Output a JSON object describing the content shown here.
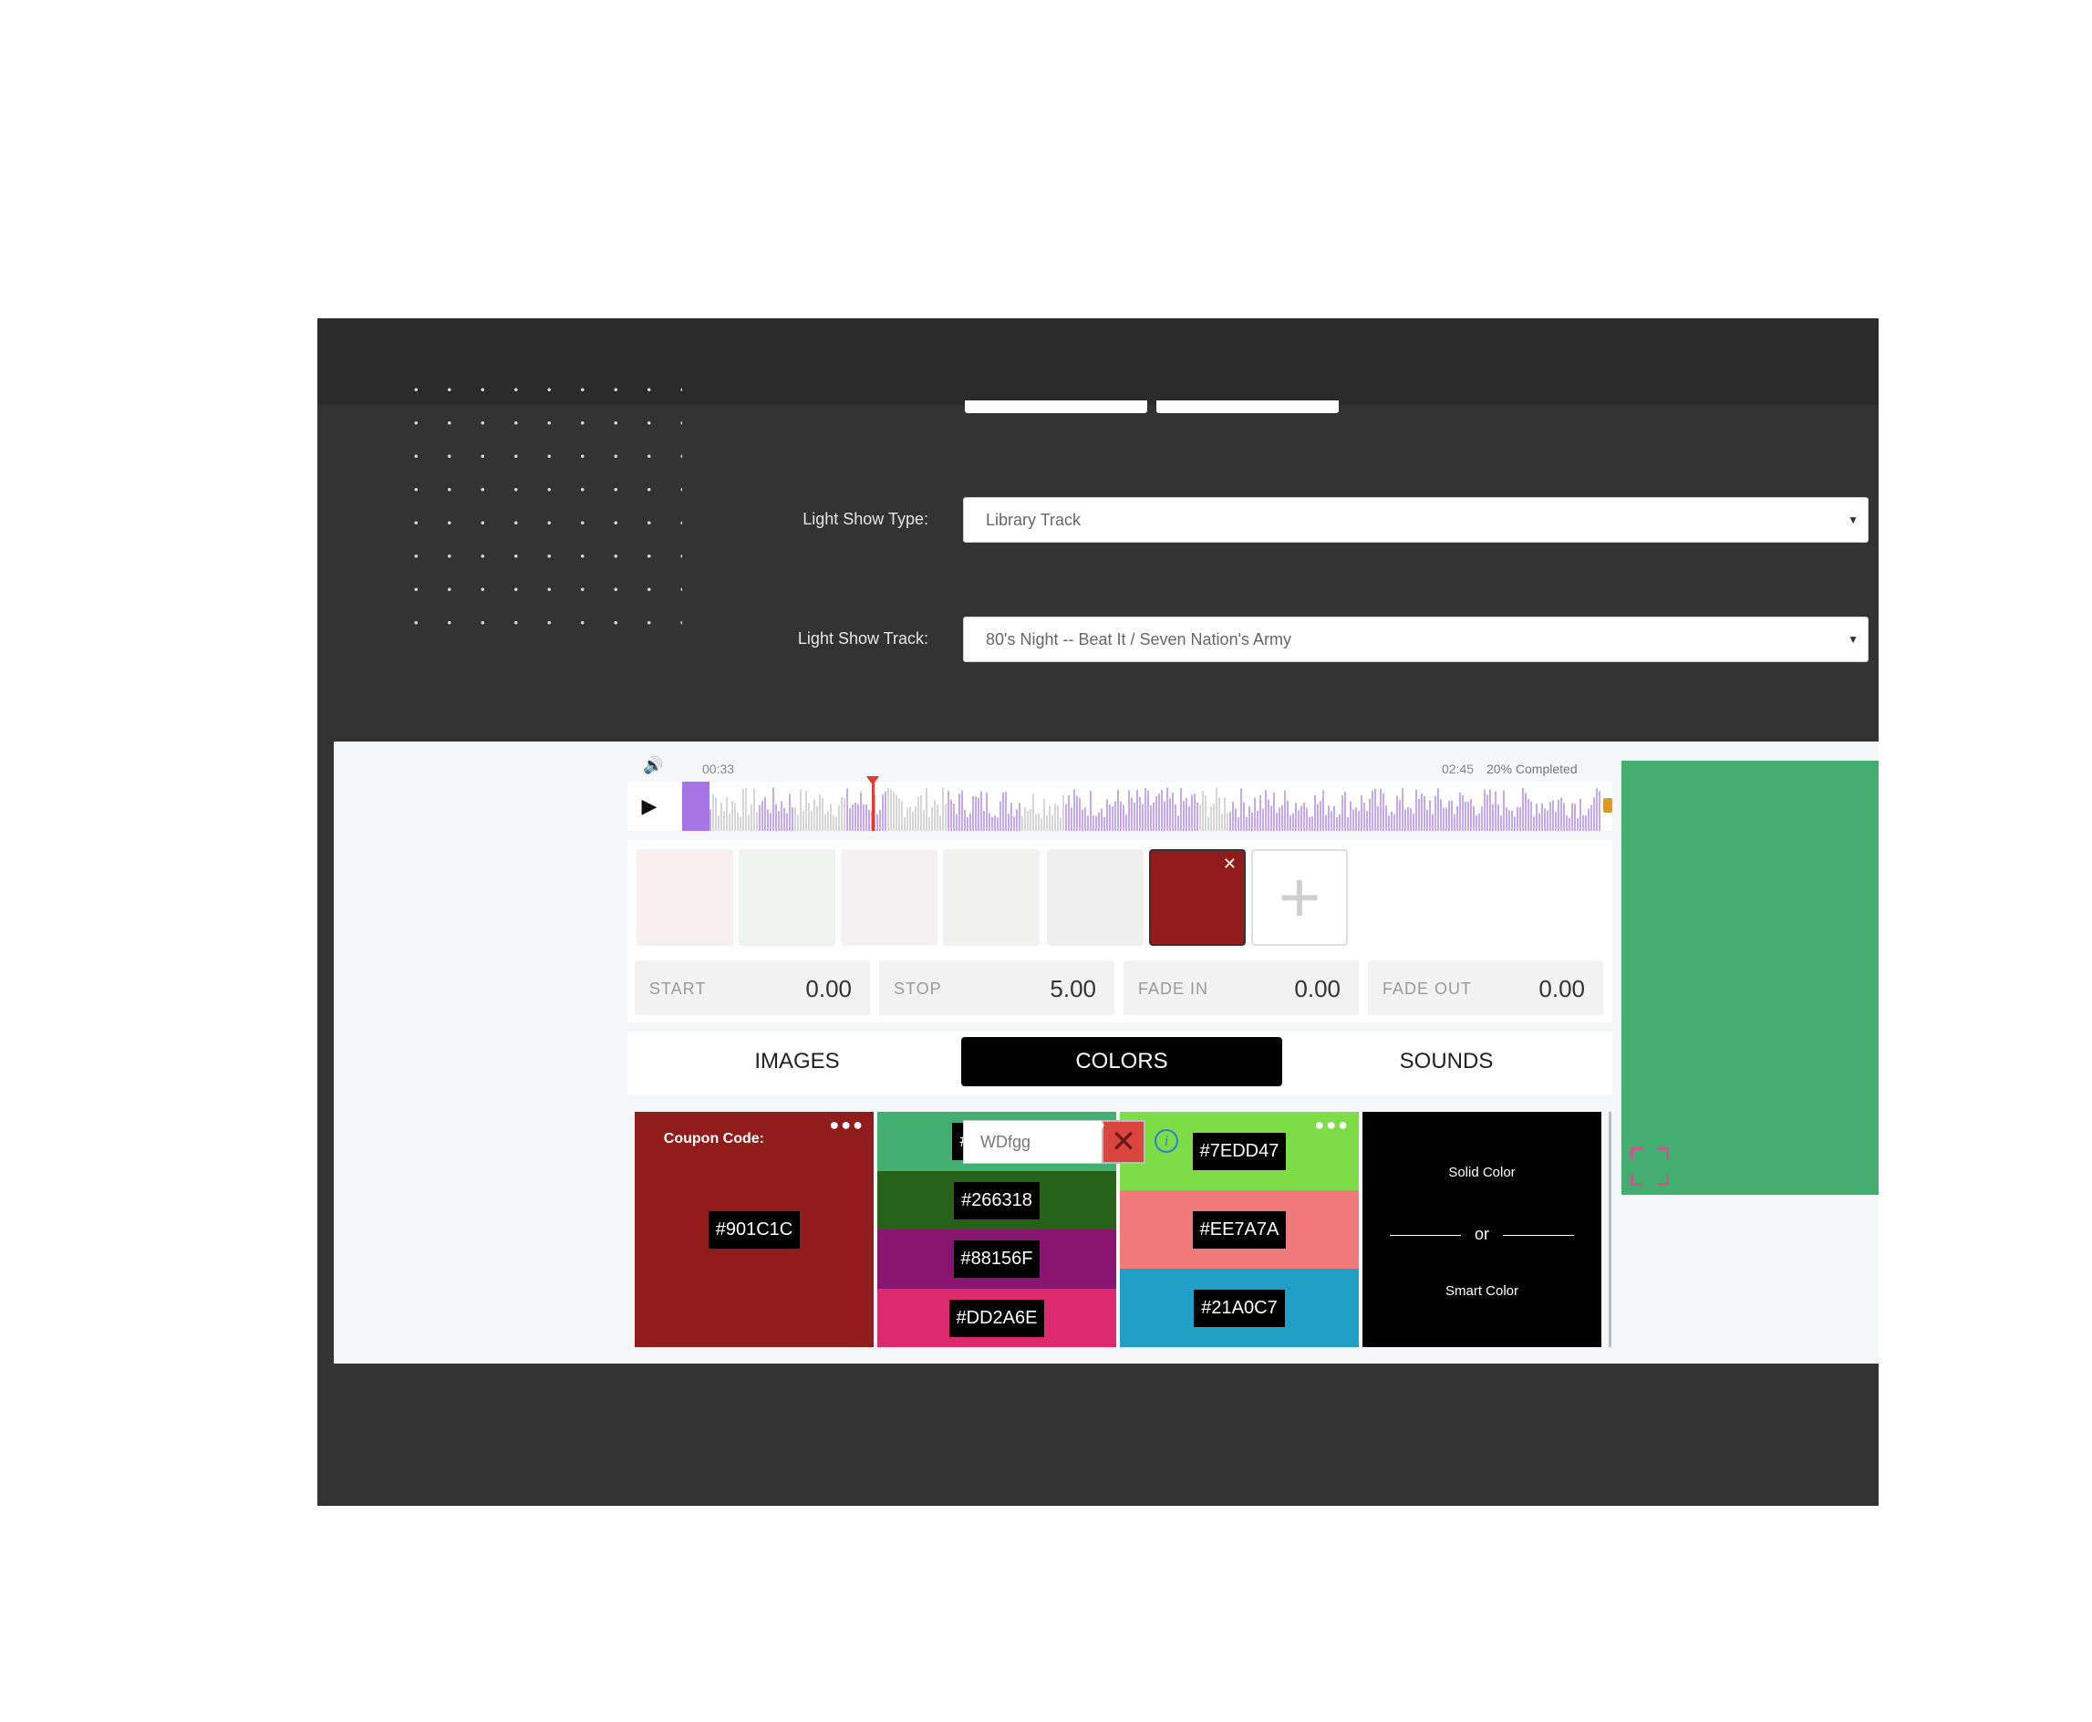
{
  "form": {
    "light_show_type_label": "Light Show Type:",
    "light_show_type_value": "Library Track",
    "light_show_track_label": "Light Show Track:",
    "light_show_track_value": "80's Night -- Beat It / Seven Nation's Army"
  },
  "player": {
    "current_time": "00:33",
    "total_time": "02:45",
    "progress_label": "20% Completed",
    "progress": 0.2,
    "play_icon": "play-icon",
    "volume_icon": "volume-icon"
  },
  "frames": {
    "thumbs": [
      {
        "color": "#f7eeee",
        "selected": false
      },
      {
        "color": "#eef3ee",
        "selected": false
      },
      {
        "color": "#f3f1f1",
        "selected": false
      },
      {
        "color": "#f0f0ee",
        "selected": false
      },
      {
        "color": "#efefef",
        "selected": false
      },
      {
        "color": "#901c1c",
        "selected": true
      }
    ],
    "remove_icon": "✕",
    "add_icon": "+"
  },
  "params": {
    "start_label": "START",
    "start_value": "0.00",
    "stop_label": "STOP",
    "stop_value": "5.00",
    "fade_in_label": "FADE IN",
    "fade_in_value": "0.00",
    "fade_out_label": "FADE OUT",
    "fade_out_value": "0.00"
  },
  "tabs": {
    "images": "IMAGES",
    "colors": "COLORS",
    "sounds": "SOUNDS",
    "active": "COLORS"
  },
  "swatches": {
    "more_icon": "●●●",
    "single": {
      "hex": "#901C1C",
      "color": "#901c1c"
    },
    "four": [
      {
        "hex": "#43AF70",
        "color": "#43af70"
      },
      {
        "hex": "#266318",
        "color": "#266318"
      },
      {
        "hex": "#88156F",
        "color": "#88156f"
      },
      {
        "hex": "#DD2A6E",
        "color": "#dd2a6e"
      }
    ],
    "three": [
      {
        "hex": "#7EDD47",
        "color": "#7edd47"
      },
      {
        "hex": "#EE7A7A",
        "color": "#ee7a7a"
      },
      {
        "hex": "#21A0C7",
        "color": "#21a0c7"
      }
    ],
    "smart": {
      "solid_label": "Solid Color",
      "or_label": "or",
      "smart_label": "Smart Color"
    }
  },
  "preview": {
    "color": "#43ae70",
    "expand_icon": "expand-icon"
  },
  "coupon": {
    "label": "Coupon Code:",
    "value": "WDfgg",
    "clear_icon": "✕",
    "info_icon": "i"
  }
}
